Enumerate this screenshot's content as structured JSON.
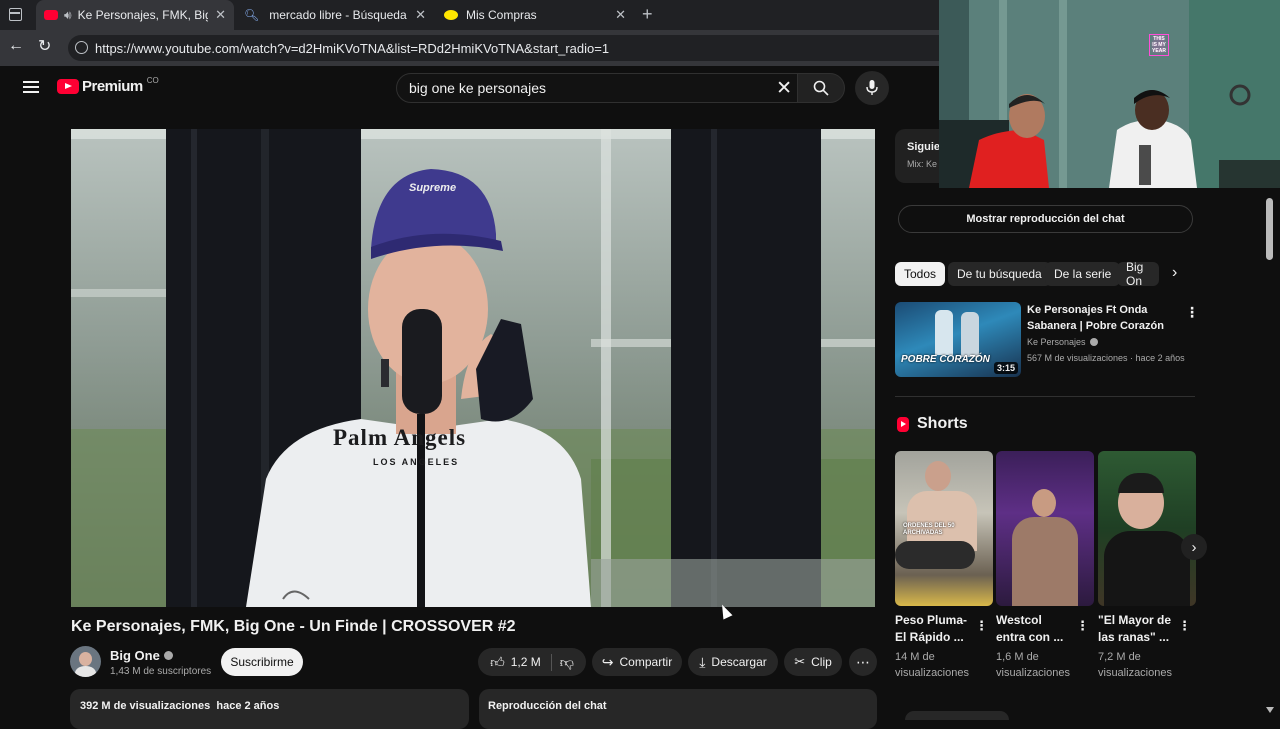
{
  "browser": {
    "tabs": [
      {
        "label": "Ke Personajes, FMK, Big One"
      },
      {
        "label": "mercado libre - Búsqueda"
      },
      {
        "label": "Mis Compras"
      }
    ],
    "url": "https://www.youtube.com/watch?v=d2HmiKVoTNA&list=RDd2HmiKVoTNA&start_radio=1"
  },
  "youtube": {
    "logo_text": "Premium",
    "logo_country": "CO",
    "search_value": "big one ke personajes",
    "video": {
      "title": "Ke Personajes, FMK, Big One - Un Finde | CROSSOVER #2",
      "channel": "Big One",
      "subscribers": "1,43 M de suscriptores",
      "subscribe_label": "Suscribirme",
      "likes": "1,2 M",
      "share_label": "Compartir",
      "download_label": "Descargar",
      "clip_label": "Clip",
      "views": "392 M de visualizaciones",
      "age": "hace 2 años",
      "chat_replay": "Reproducción del chat",
      "shirt_text": "Palm Angels",
      "shirt_subtext": "LOS ANGELES",
      "cap_text": "Supreme"
    },
    "sidebar": {
      "next_label": "Siguie",
      "next_sub": "Mix: Ke",
      "chat_button": "Mostrar reproducción del chat",
      "chips": [
        "Todos",
        "De tu búsqueda",
        "De la serie",
        "Big On"
      ],
      "rec": {
        "title": "Ke Personajes Ft  Onda Sabanera | Pobre Corazón",
        "channel": "Ke Personajes",
        "meta": "567 M de visualizaciones · hace 2 años",
        "duration": "3:15",
        "thumb_text": "POBRE CORAZÓN"
      },
      "shorts_title": "Shorts",
      "shorts": [
        {
          "title": "Peso Pluma- El Rápido ...",
          "views": "14 M de visualizaciones",
          "thumb_text": "ORDENES DEL 50 ARCHIVADAS"
        },
        {
          "title": "Westcol entra con ...",
          "views": "1,6 M de visualizaciones",
          "thumb_text": ""
        },
        {
          "title": "\"El Mayor de las ranas\" ...",
          "views": "7,2 M de visualizaciones",
          "thumb_text": ""
        }
      ]
    },
    "overlay": {
      "neon_text": "THIS IS MY YEAR"
    }
  },
  "colors": {
    "youtube_red": "#ff0033",
    "background": "#0f0f0f",
    "chip": "#272727"
  }
}
